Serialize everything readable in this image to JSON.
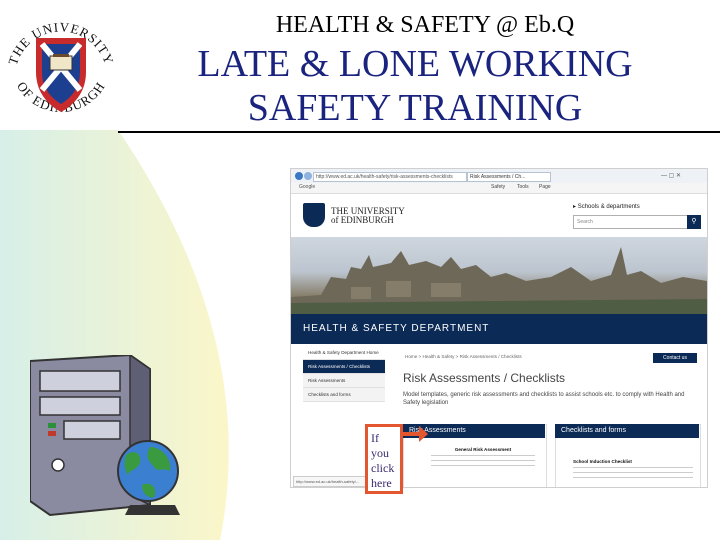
{
  "slide": {
    "line1": "HEALTH & SAFETY @ Eb.Q",
    "line2": "LATE & LONE WORKING",
    "line3": "SAFETY TRAINING",
    "callout": [
      "If",
      "you",
      "click",
      "here"
    ]
  },
  "logo": {
    "top_arc": "THE UNIVERSITY",
    "bottom_arc": "OF EDINBURGH"
  },
  "browser": {
    "address": "http://www.ed.ac.uk/health-safety/risk-assessments-checklists",
    "tab_label": "Risk Assessments / Ch...",
    "toolbar_left": "Google",
    "toolbar_items": [
      "Safety",
      "Tools",
      "Page"
    ],
    "window_controls": "— ▢ ✕",
    "status_url": "http://www.ed.ac.uk/health-safety/..."
  },
  "site": {
    "uni_line1": "THE UNIVERSITY",
    "uni_line2": "of EDINBURGH",
    "schools_link": "Schools & departments",
    "search_placeholder": "Search",
    "dept_title": "HEALTH & SAFETY DEPARTMENT",
    "side_items": [
      {
        "label": "Health & Safety Department Home"
      },
      {
        "label": "Risk Assessments / Checklists"
      },
      {
        "label": "Risk Assessments"
      },
      {
        "label": "Checklists and forms"
      }
    ],
    "breadcrumb": "Home  >  Health & Safety  >  Risk Assessments / Checklists",
    "contact_label": "Contact us",
    "page_heading": "Risk Assessments / Checklists",
    "intro": "Model templates, generic risk assessments and checklists to assist schools etc. to comply with Health and Safety legislation",
    "panel_left_title": "Risk Assessments",
    "panel_right_title": "Checklists and forms",
    "panel_left_doc": "General Risk Assessment",
    "panel_right_doc": "School Induction Checklist"
  },
  "colors": {
    "navy": "#0b2a55",
    "slide_title": "#1a237e",
    "callout_border": "#e4572e",
    "left_wave": "#f6f3c7"
  }
}
